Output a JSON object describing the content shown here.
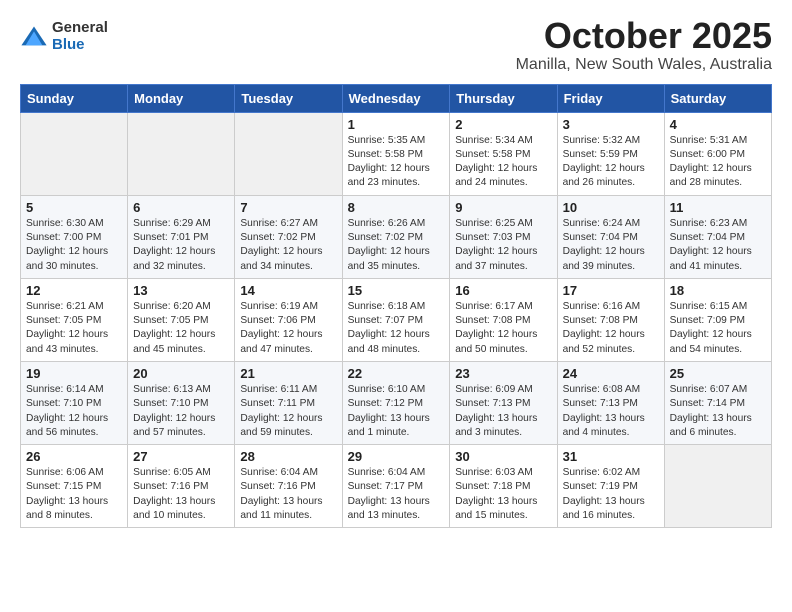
{
  "logo": {
    "general": "General",
    "blue": "Blue"
  },
  "title": "October 2025",
  "location": "Manilla, New South Wales, Australia",
  "weekdays": [
    "Sunday",
    "Monday",
    "Tuesday",
    "Wednesday",
    "Thursday",
    "Friday",
    "Saturday"
  ],
  "weeks": [
    [
      {
        "day": "",
        "info": ""
      },
      {
        "day": "",
        "info": ""
      },
      {
        "day": "",
        "info": ""
      },
      {
        "day": "1",
        "info": "Sunrise: 5:35 AM\nSunset: 5:58 PM\nDaylight: 12 hours\nand 23 minutes."
      },
      {
        "day": "2",
        "info": "Sunrise: 5:34 AM\nSunset: 5:58 PM\nDaylight: 12 hours\nand 24 minutes."
      },
      {
        "day": "3",
        "info": "Sunrise: 5:32 AM\nSunset: 5:59 PM\nDaylight: 12 hours\nand 26 minutes."
      },
      {
        "day": "4",
        "info": "Sunrise: 5:31 AM\nSunset: 6:00 PM\nDaylight: 12 hours\nand 28 minutes."
      }
    ],
    [
      {
        "day": "5",
        "info": "Sunrise: 6:30 AM\nSunset: 7:00 PM\nDaylight: 12 hours\nand 30 minutes."
      },
      {
        "day": "6",
        "info": "Sunrise: 6:29 AM\nSunset: 7:01 PM\nDaylight: 12 hours\nand 32 minutes."
      },
      {
        "day": "7",
        "info": "Sunrise: 6:27 AM\nSunset: 7:02 PM\nDaylight: 12 hours\nand 34 minutes."
      },
      {
        "day": "8",
        "info": "Sunrise: 6:26 AM\nSunset: 7:02 PM\nDaylight: 12 hours\nand 35 minutes."
      },
      {
        "day": "9",
        "info": "Sunrise: 6:25 AM\nSunset: 7:03 PM\nDaylight: 12 hours\nand 37 minutes."
      },
      {
        "day": "10",
        "info": "Sunrise: 6:24 AM\nSunset: 7:04 PM\nDaylight: 12 hours\nand 39 minutes."
      },
      {
        "day": "11",
        "info": "Sunrise: 6:23 AM\nSunset: 7:04 PM\nDaylight: 12 hours\nand 41 minutes."
      }
    ],
    [
      {
        "day": "12",
        "info": "Sunrise: 6:21 AM\nSunset: 7:05 PM\nDaylight: 12 hours\nand 43 minutes."
      },
      {
        "day": "13",
        "info": "Sunrise: 6:20 AM\nSunset: 7:05 PM\nDaylight: 12 hours\nand 45 minutes."
      },
      {
        "day": "14",
        "info": "Sunrise: 6:19 AM\nSunset: 7:06 PM\nDaylight: 12 hours\nand 47 minutes."
      },
      {
        "day": "15",
        "info": "Sunrise: 6:18 AM\nSunset: 7:07 PM\nDaylight: 12 hours\nand 48 minutes."
      },
      {
        "day": "16",
        "info": "Sunrise: 6:17 AM\nSunset: 7:08 PM\nDaylight: 12 hours\nand 50 minutes."
      },
      {
        "day": "17",
        "info": "Sunrise: 6:16 AM\nSunset: 7:08 PM\nDaylight: 12 hours\nand 52 minutes."
      },
      {
        "day": "18",
        "info": "Sunrise: 6:15 AM\nSunset: 7:09 PM\nDaylight: 12 hours\nand 54 minutes."
      }
    ],
    [
      {
        "day": "19",
        "info": "Sunrise: 6:14 AM\nSunset: 7:10 PM\nDaylight: 12 hours\nand 56 minutes."
      },
      {
        "day": "20",
        "info": "Sunrise: 6:13 AM\nSunset: 7:10 PM\nDaylight: 12 hours\nand 57 minutes."
      },
      {
        "day": "21",
        "info": "Sunrise: 6:11 AM\nSunset: 7:11 PM\nDaylight: 12 hours\nand 59 minutes."
      },
      {
        "day": "22",
        "info": "Sunrise: 6:10 AM\nSunset: 7:12 PM\nDaylight: 13 hours\nand 1 minute."
      },
      {
        "day": "23",
        "info": "Sunrise: 6:09 AM\nSunset: 7:13 PM\nDaylight: 13 hours\nand 3 minutes."
      },
      {
        "day": "24",
        "info": "Sunrise: 6:08 AM\nSunset: 7:13 PM\nDaylight: 13 hours\nand 4 minutes."
      },
      {
        "day": "25",
        "info": "Sunrise: 6:07 AM\nSunset: 7:14 PM\nDaylight: 13 hours\nand 6 minutes."
      }
    ],
    [
      {
        "day": "26",
        "info": "Sunrise: 6:06 AM\nSunset: 7:15 PM\nDaylight: 13 hours\nand 8 minutes."
      },
      {
        "day": "27",
        "info": "Sunrise: 6:05 AM\nSunset: 7:16 PM\nDaylight: 13 hours\nand 10 minutes."
      },
      {
        "day": "28",
        "info": "Sunrise: 6:04 AM\nSunset: 7:16 PM\nDaylight: 13 hours\nand 11 minutes."
      },
      {
        "day": "29",
        "info": "Sunrise: 6:04 AM\nSunset: 7:17 PM\nDaylight: 13 hours\nand 13 minutes."
      },
      {
        "day": "30",
        "info": "Sunrise: 6:03 AM\nSunset: 7:18 PM\nDaylight: 13 hours\nand 15 minutes."
      },
      {
        "day": "31",
        "info": "Sunrise: 6:02 AM\nSunset: 7:19 PM\nDaylight: 13 hours\nand 16 minutes."
      },
      {
        "day": "",
        "info": ""
      }
    ]
  ]
}
